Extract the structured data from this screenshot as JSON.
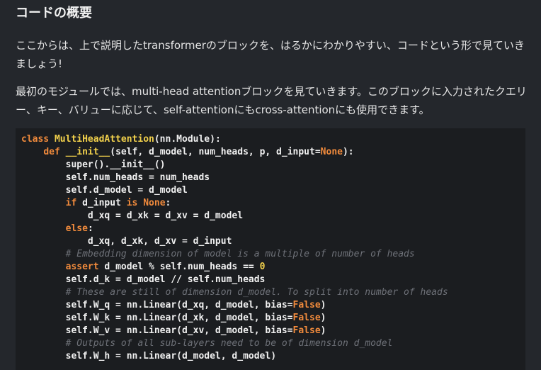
{
  "heading": "コードの概要",
  "paragraphs": [
    "ここからは、上で説明したtransformerのブロックを、はるかにわかりやすい、コードという形で見ていきましょう!",
    "最初のモジュールでは、multi-head attentionブロックを見ていきます。このブロックに入力されたクエリー、キー、バリューに応じて、self-attentionにもcross-attentionにも使用できます。"
  ],
  "code": {
    "language": "python",
    "lines": [
      [
        {
          "t": "class ",
          "c": "kw"
        },
        {
          "t": "MultiHeadAttention",
          "c": "fn"
        },
        {
          "t": "(nn.Module):",
          "c": ""
        }
      ],
      [
        {
          "t": "    ",
          "c": ""
        },
        {
          "t": "def ",
          "c": "kw"
        },
        {
          "t": "__init__",
          "c": "fn"
        },
        {
          "t": "(self, d_model, num_heads, p, d_input=",
          "c": ""
        },
        {
          "t": "None",
          "c": "kw"
        },
        {
          "t": "):",
          "c": ""
        }
      ],
      [
        {
          "t": "        super().__init__()",
          "c": ""
        }
      ],
      [
        {
          "t": "        self.num_heads = num_heads",
          "c": ""
        }
      ],
      [
        {
          "t": "        self.d_model = d_model",
          "c": ""
        }
      ],
      [
        {
          "t": "        ",
          "c": ""
        },
        {
          "t": "if ",
          "c": "kw"
        },
        {
          "t": "d_input ",
          "c": ""
        },
        {
          "t": "is None",
          "c": "kw"
        },
        {
          "t": ":",
          "c": ""
        }
      ],
      [
        {
          "t": "            d_xq = d_xk = d_xv = d_model",
          "c": ""
        }
      ],
      [
        {
          "t": "        ",
          "c": ""
        },
        {
          "t": "else",
          "c": "kw"
        },
        {
          "t": ":",
          "c": ""
        }
      ],
      [
        {
          "t": "            d_xq, d_xk, d_xv = d_input",
          "c": ""
        }
      ],
      [
        {
          "t": "        ",
          "c": ""
        },
        {
          "t": "# Embedding dimension of model is a multiple of number of heads",
          "c": "cm"
        }
      ],
      [
        {
          "t": "        ",
          "c": ""
        },
        {
          "t": "assert ",
          "c": "kw"
        },
        {
          "t": "d_model % self.num_heads == ",
          "c": ""
        },
        {
          "t": "0",
          "c": "fn"
        }
      ],
      [
        {
          "t": "        self.d_k = d_model // self.num_heads",
          "c": ""
        }
      ],
      [
        {
          "t": "        ",
          "c": ""
        },
        {
          "t": "# These are still of dimension d_model. To split into number of heads",
          "c": "cm"
        }
      ],
      [
        {
          "t": "        self.W_q = nn.Linear(d_xq, d_model, bias=",
          "c": ""
        },
        {
          "t": "False",
          "c": "kw"
        },
        {
          "t": ")",
          "c": ""
        }
      ],
      [
        {
          "t": "        self.W_k = nn.Linear(d_xk, d_model, bias=",
          "c": ""
        },
        {
          "t": "False",
          "c": "kw"
        },
        {
          "t": ")",
          "c": ""
        }
      ],
      [
        {
          "t": "        self.W_v = nn.Linear(d_xv, d_model, bias=",
          "c": ""
        },
        {
          "t": "False",
          "c": "kw"
        },
        {
          "t": ")",
          "c": ""
        }
      ],
      [
        {
          "t": "        ",
          "c": ""
        },
        {
          "t": "# Outputs of all sub-layers need to be of dimension d_model",
          "c": "cm"
        }
      ],
      [
        {
          "t": "        self.W_h = nn.Linear(d_model, d_model)",
          "c": ""
        }
      ]
    ]
  },
  "colors": {
    "background": "#24272c",
    "code_background": "#1b1d20",
    "keyword": "#f08a3c",
    "function": "#f1d04b",
    "comment": "#6e7178"
  }
}
